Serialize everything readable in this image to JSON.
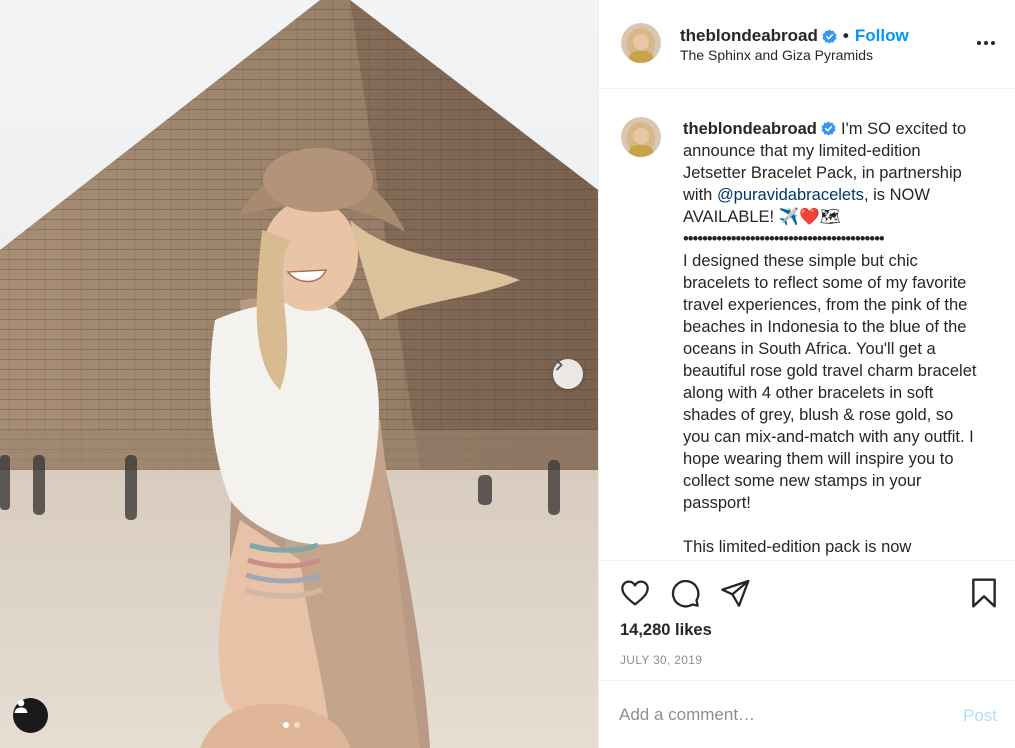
{
  "post": {
    "username": "theblondeabroad",
    "follow_separator": "•",
    "follow_label": "Follow",
    "location": "The Sphinx and Giza Pyramids"
  },
  "caption": {
    "username": "theblondeabroad",
    "intro_before_mention": "I'm SO excited to announce that my limited-edition Jetsetter Bracelet Pack, in partnership with ",
    "mention": "@puravidabracelets",
    "intro_after_mention": ", is NOW AVAILABLE! ✈️❤️🗺",
    "divider": "••••••••••••••••••••••••••••••••••••••••••",
    "body": "I designed these simple but chic bracelets to reflect some of my favorite travel experiences, from the pink of the beaches in Indonesia to the blue of the oceans in South Africa. You'll get a beautiful rose gold travel charm bracelet along with 4 other bracelets in soft shades of grey, blush & rose gold, so you can mix-and-match with any outfit. I hope wearing them will inspire you to collect some new stamps in your passport!",
    "body_2": "This limited-edition pack is now"
  },
  "stats": {
    "likes": "14,280 likes",
    "date": "JULY 30, 2019"
  },
  "comment": {
    "placeholder": "Add a comment…",
    "post_label": "Post"
  },
  "icons": {
    "like": "heart-icon",
    "comment": "comment-bubble-icon",
    "share": "paper-plane-icon",
    "save": "bookmark-icon",
    "next": "chevron-right-icon",
    "tag": "user-tag-icon",
    "more": "more-options-icon",
    "verified": "verified-badge-icon"
  },
  "colors": {
    "accent": "#0095f6",
    "mention": "#00376b",
    "muted": "#8e8e8e",
    "post_disabled": "#b2dffc"
  },
  "carousel": {
    "total": 2,
    "active": 1
  }
}
